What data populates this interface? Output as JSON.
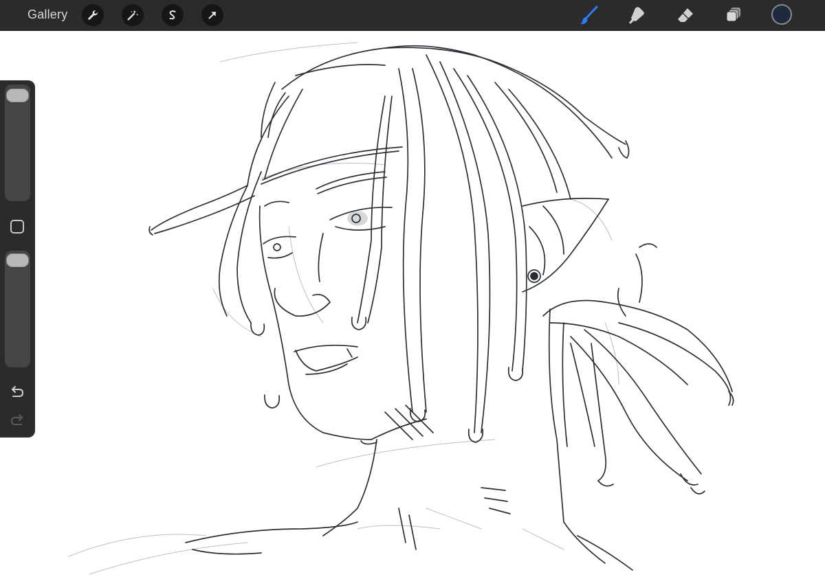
{
  "toolbar": {
    "gallery_label": "Gallery",
    "actions": [
      {
        "icon": "wrench-icon",
        "name": "actions-button"
      },
      {
        "icon": "magic-wand-icon",
        "name": "adjustments-button"
      },
      {
        "icon": "selection-s-icon",
        "name": "selection-button"
      },
      {
        "icon": "arrow-cursor-icon",
        "name": "transform-button"
      }
    ],
    "tools": [
      {
        "icon": "brush-icon",
        "name": "brush-tool",
        "active": true
      },
      {
        "icon": "smudge-icon",
        "name": "smudge-tool"
      },
      {
        "icon": "eraser-icon",
        "name": "eraser-tool"
      },
      {
        "icon": "layers-icon",
        "name": "layers-tool"
      }
    ],
    "color": "#1d2b3d"
  },
  "colors": {
    "toolbar_bg": "#2b2b2d",
    "accent_active": "#2f7cf6",
    "icon_inactive": "#d0d0d0",
    "stroke": "#2a2d33"
  },
  "sidebar": {
    "brush_size": 0.95,
    "opacity": 0.95,
    "undo_icon": "undo-icon",
    "redo_icon": "redo-icon",
    "redo_enabled": false
  }
}
